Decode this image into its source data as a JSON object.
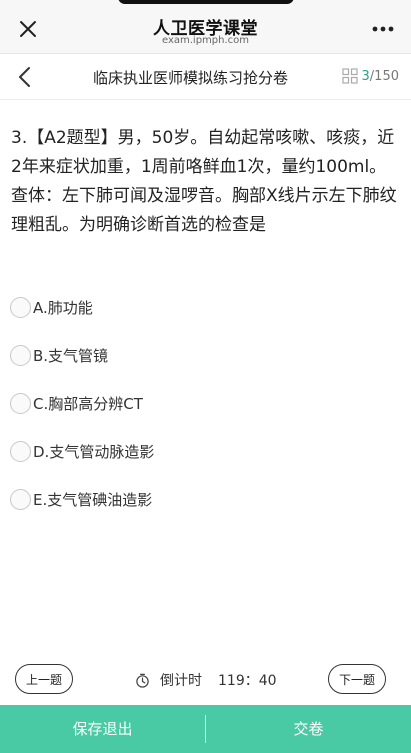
{
  "browser": {
    "site_title": "人卫医学课堂",
    "site_url": "exam.ipmph.com"
  },
  "nav": {
    "title": "临床执业医师模拟练习抢分卷",
    "progress_current": "3",
    "progress_total": "/150"
  },
  "question": {
    "text": "3.【A2题型】男，50岁。自幼起常咳嗽、咳痰，近2年来症状加重，1周前咯鲜血1次，量约100ml。查体：左下肺可闻及湿啰音。胸部X线片示左下肺纹理粗乱。为明确诊断首选的检查是"
  },
  "options": [
    {
      "label": "A.肺功能"
    },
    {
      "label": "B.支气管镜"
    },
    {
      "label": "C.胸部高分辨CT"
    },
    {
      "label": "D.支气管动脉造影"
    },
    {
      "label": "E.支气管碘油造影"
    }
  ],
  "controls": {
    "prev_label": "上一题",
    "next_label": "下一题",
    "timer_label": "倒计时",
    "timer_value": "119：40"
  },
  "bottom": {
    "save_exit_label": "保存退出",
    "submit_label": "交卷"
  },
  "colors": {
    "accent": "#2aa38a",
    "bottom_bar": "#49c9a4"
  }
}
